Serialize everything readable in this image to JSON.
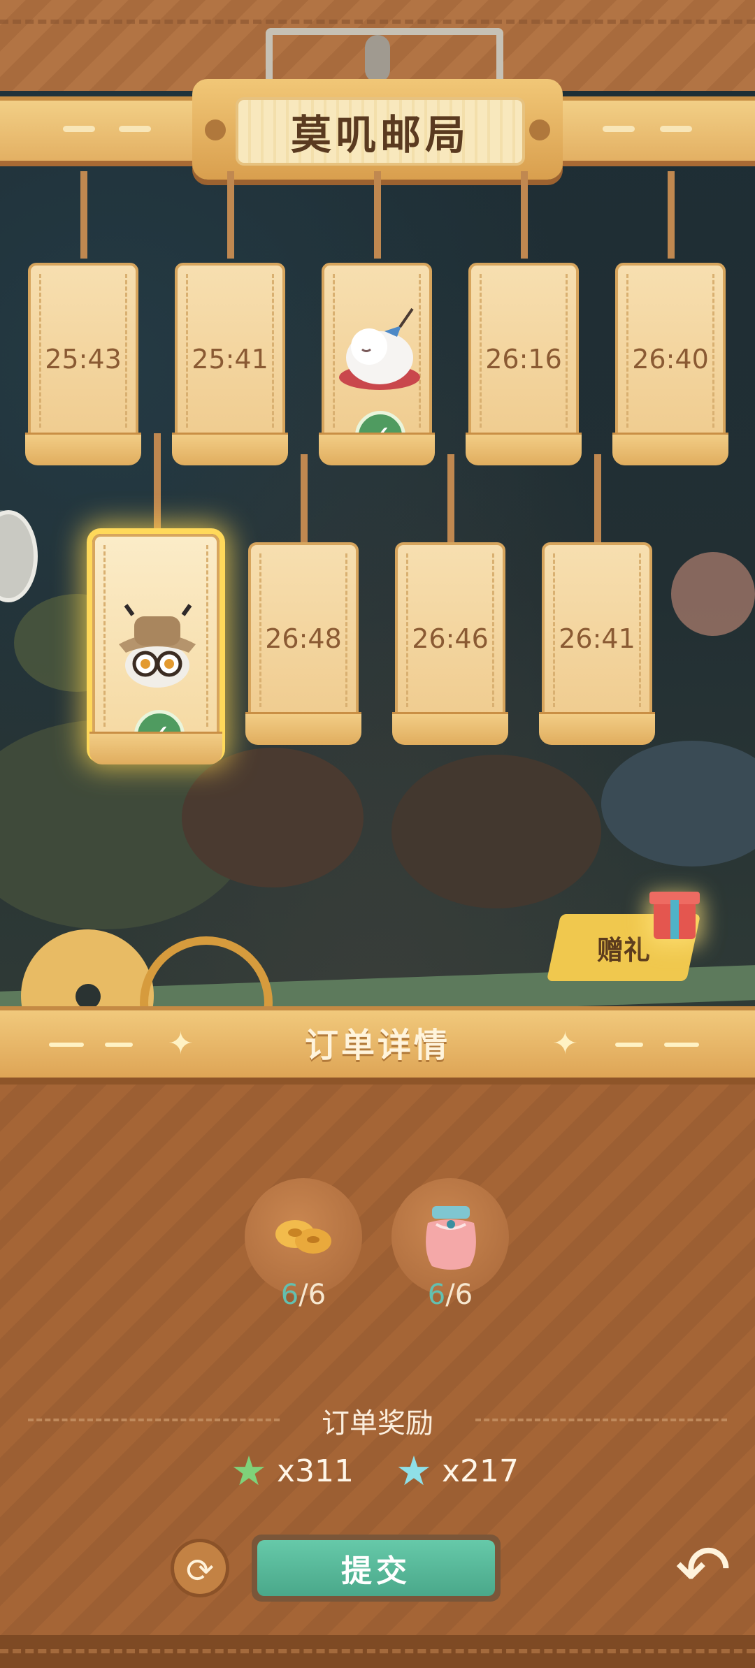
{
  "header": {
    "title": "莫叽邮局"
  },
  "tags_row1": [
    {
      "time": "25:43",
      "completed": false
    },
    {
      "time": "25:41",
      "completed": false
    },
    {
      "time": "",
      "completed": true,
      "icon": "sleeping-white-creature-icon"
    },
    {
      "time": "26:16",
      "completed": false
    },
    {
      "time": "26:40",
      "completed": false
    }
  ],
  "tags_row2": [
    {
      "time": "",
      "completed": true,
      "selected": true,
      "icon": "owl-with-hat-icon"
    },
    {
      "time": "26:48",
      "completed": false
    },
    {
      "time": "26:46",
      "completed": false
    },
    {
      "time": "26:41",
      "completed": false
    }
  ],
  "gift": {
    "label": "赠礼"
  },
  "order": {
    "title": "订单详情",
    "items": [
      {
        "icon": "pastry-icon",
        "have": "6",
        "need": "/6"
      },
      {
        "icon": "jam-jar-icon",
        "have": "6",
        "need": "/6"
      }
    ],
    "reward_title": "订单奖励",
    "rewards": [
      {
        "icon": "green-star-icon",
        "amount": "x311"
      },
      {
        "icon": "blue-star-icon",
        "amount": "x217"
      }
    ]
  },
  "actions": {
    "submit": "提交"
  },
  "colors": {
    "accent_green": "#4aa88a",
    "have_count": "#63c0b0",
    "wood": "#a56536"
  }
}
